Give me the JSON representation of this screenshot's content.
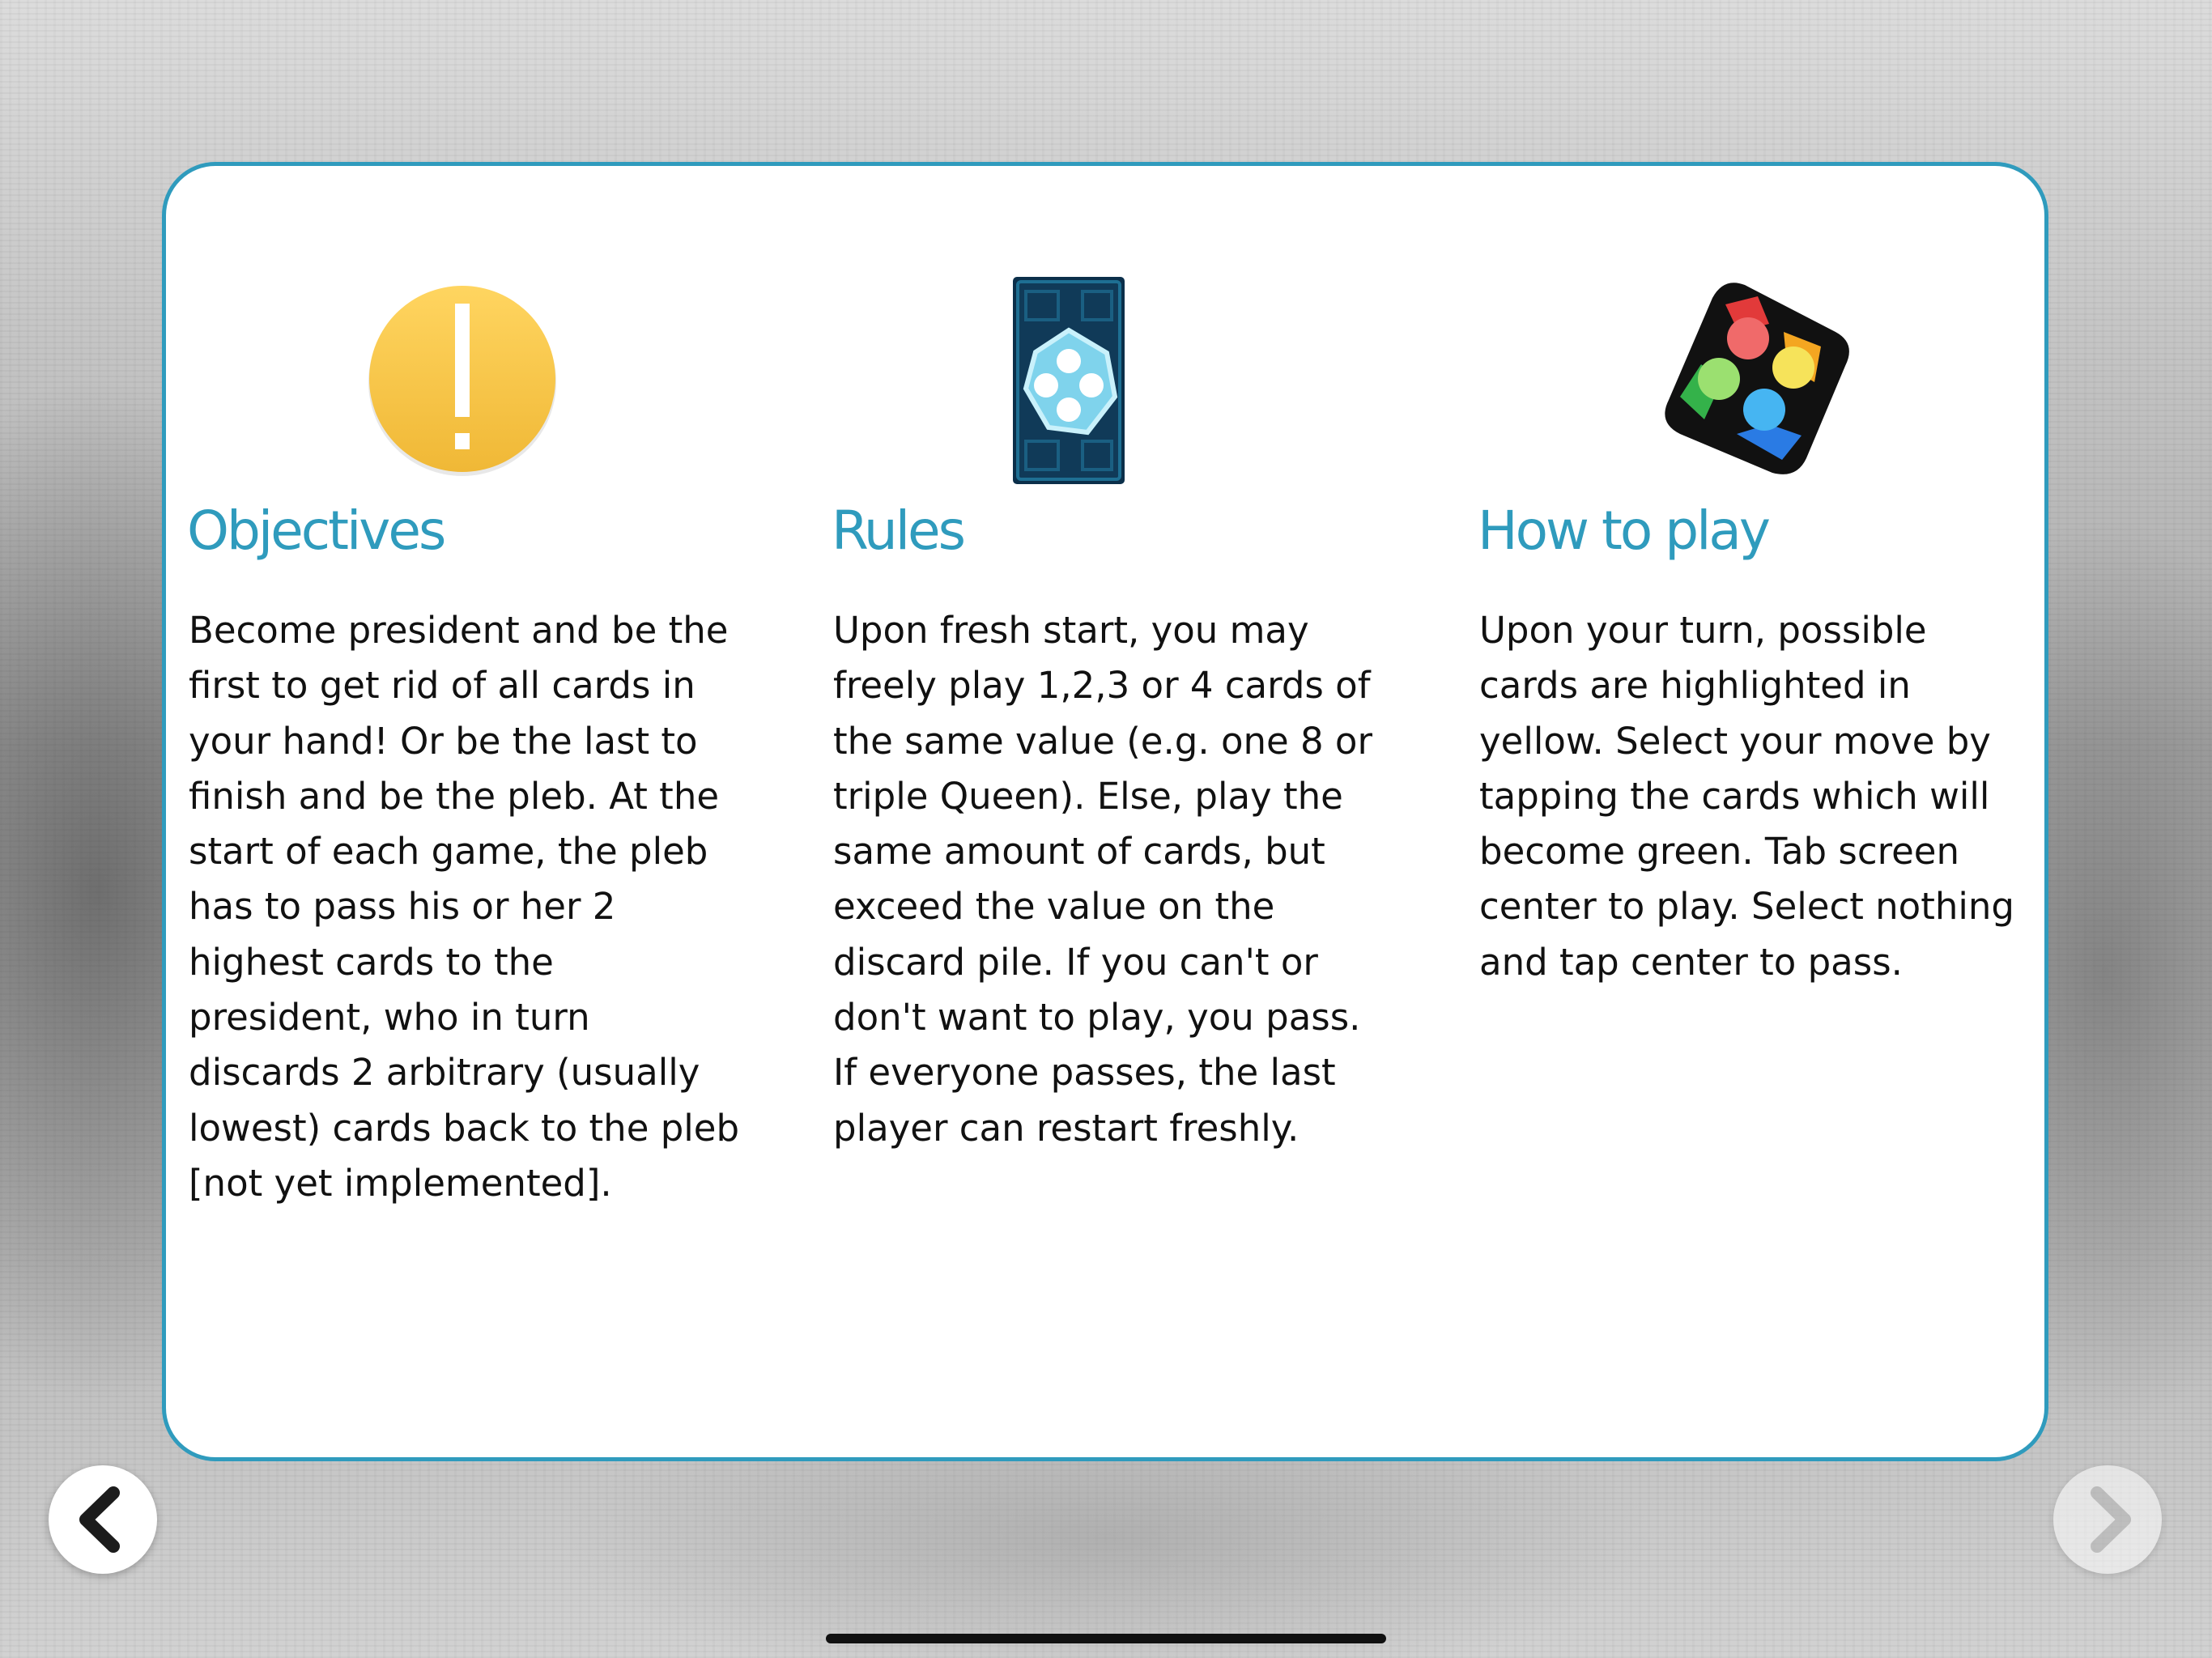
{
  "colors": {
    "accent": "#2f9bbd",
    "panel_background": "#ffffff",
    "body_text": "#111111"
  },
  "columns": [
    {
      "icon": "exclamation-circle-icon",
      "title": "Objectives",
      "text": "Become president and be the first to get rid of all cards in your hand! Or be the last to finish and be the pleb. At the start of each game, the pleb has to pass his or her 2 highest cards to the president, who in turn discards 2 arbitrary (usually lowest) cards back to the pleb [not yet implemented]."
    },
    {
      "icon": "card-back-icon",
      "title": "Rules",
      "text": "Upon fresh start, you may freely play 1,2,3 or 4 cards of the same value (e.g. one 8 or triple Queen). Else, play the same amount of cards, but exceed the value on the discard pile. If you can't or don't want to play, you pass. If everyone passes, the last player can restart freshly."
    },
    {
      "icon": "game-controller-icon",
      "title": "How to play",
      "text": "Upon your turn, possible cards are highlighted in yellow. Select your move by tapping the cards which will become green. Tab screen center to play. Select nothing and tap center to pass."
    }
  ],
  "navigation": {
    "back_icon": "chevron-left-icon",
    "next_icon": "chevron-right-icon",
    "next_enabled": false
  }
}
